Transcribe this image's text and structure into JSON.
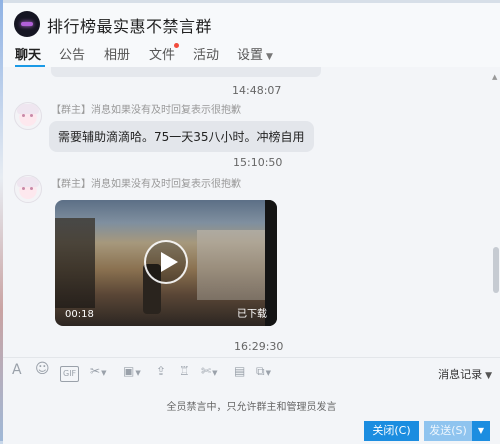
{
  "window": {
    "title": "排行榜最实惠不禁言群"
  },
  "tabs": [
    {
      "label": "聊天",
      "active": true
    },
    {
      "label": "公告"
    },
    {
      "label": "相册"
    },
    {
      "label": "文件",
      "has_dot": true
    },
    {
      "label": "活动"
    },
    {
      "label": "设置",
      "has_caret": true
    }
  ],
  "messages": [
    {
      "timestamp": "14:48:07",
      "sender": "【群主】消息如果没有及时回复表示很抱歉",
      "text": "需要辅助滴滴哈。75一天35八小时。冲榜自用"
    },
    {
      "timestamp": "15:10:50",
      "sender": "【群主】消息如果没有及时回复表示很抱歉",
      "video": {
        "duration": "00:18",
        "status": "已下载"
      }
    }
  ],
  "last_timestamp": "16:29:30",
  "toolbar": {
    "icons": [
      "font-icon",
      "emoji-icon",
      "gif-icon",
      "screenshot-icon",
      "image-icon",
      "upload-icon",
      "gift-icon",
      "scissors-icon",
      "clipboard-icon",
      "remote-icon"
    ],
    "history_label": "消息记录"
  },
  "mute_note": "全员禁言中，只允许群主和管理员发言",
  "buttons": {
    "close": "关闭(C)",
    "send": "发送(S)"
  }
}
